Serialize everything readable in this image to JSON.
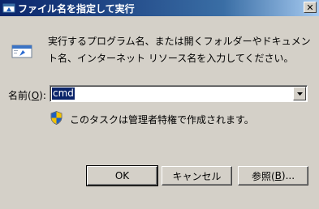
{
  "window": {
    "title": "ファイル名を指定して実行",
    "close_glyph": "✕"
  },
  "description": "実行するプログラム名、または開くフォルダーやドキュメント名、インターネット リソース名を入力してください。",
  "open_field": {
    "label_prefix": "名前(",
    "label_access_key": "O",
    "label_suffix": "):",
    "value": "cmd"
  },
  "admin_notice": "このタスクは管理者特権で作成されます。",
  "buttons": {
    "ok": "OK",
    "cancel": "キャンセル",
    "browse_prefix": "参照(",
    "browse_access_key": "B",
    "browse_suffix": ")..."
  },
  "icons": {
    "title": "run-icon",
    "dialog": "run-icon",
    "uac": "uac-shield-icon",
    "dropdown": "chevron-down-icon"
  },
  "colors": {
    "title_bar_start": "#0a246a",
    "title_bar_end": "#a6caf0",
    "dialog_face": "#d4d0c8",
    "selection": "#0a246a"
  }
}
